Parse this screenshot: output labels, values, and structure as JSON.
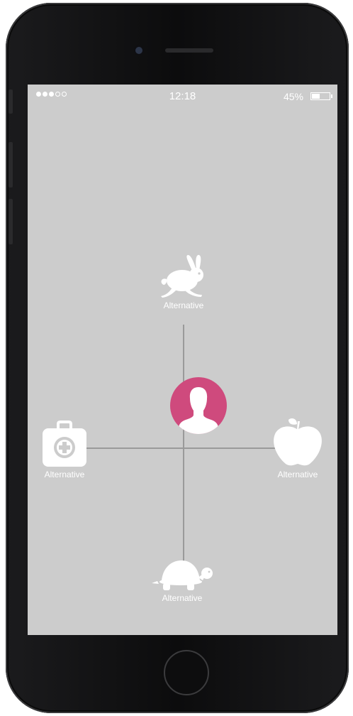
{
  "status_bar": {
    "time": "12:18",
    "battery_percent": "45%",
    "battery_level": 0.45,
    "signal_bars": 3,
    "signal_total": 5
  },
  "center": {
    "avatar_icon": "person-icon",
    "color": "#cf4a7d"
  },
  "options": [
    {
      "label": "Alternative",
      "icon": "rabbit-icon"
    },
    {
      "label": "Alternative",
      "icon": "first-aid-kit-icon"
    },
    {
      "label": "Alternative",
      "icon": "apple-icon"
    },
    {
      "label": "Alternative",
      "icon": "turtle-icon"
    }
  ]
}
